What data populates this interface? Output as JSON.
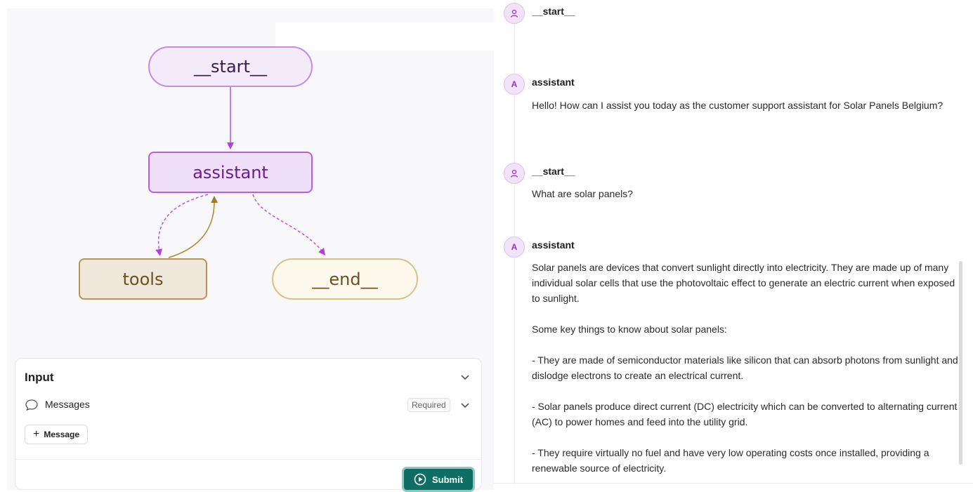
{
  "graph": {
    "nodes": {
      "start": "__start__",
      "assistant": "assistant",
      "tools": "tools",
      "end": "__end__"
    },
    "edge_colors": {
      "solid": "#b660dd",
      "dashed": "#c050dd",
      "return": "#b08a3e"
    }
  },
  "input": {
    "title": "Input",
    "messages_label": "Messages",
    "required_badge": "Required",
    "add_message_label": "Message",
    "submit_label": "Submit"
  },
  "chat": {
    "messages": [
      {
        "role": "__start__",
        "avatar": "user-icon",
        "paragraphs": []
      },
      {
        "role": "assistant",
        "avatar": "A",
        "paragraphs": [
          "Hello! How can I assist you today as the customer support assistant for Solar Panels Belgium?"
        ]
      },
      {
        "role": "__start__",
        "avatar": "user-icon",
        "paragraphs": [
          "What are solar panels?"
        ]
      },
      {
        "role": "assistant",
        "avatar": "A",
        "paragraphs": [
          "Solar panels are devices that convert sunlight directly into electricity. They are made up of many individual solar cells that use the photovoltaic effect to generate an electric current when exposed to sunlight.",
          "Some key things to know about solar panels:",
          "- They are made of semiconductor materials like silicon that can absorb photons from sunlight and dislodge electrons to create an electrical current.",
          "- Solar panels produce direct current (DC) electricity which can be converted to alternating current (AC) to power homes and feed into the utility grid.",
          "- They require virtually no fuel and have very low operating costs once installed, providing a renewable source of electricity."
        ]
      }
    ]
  }
}
